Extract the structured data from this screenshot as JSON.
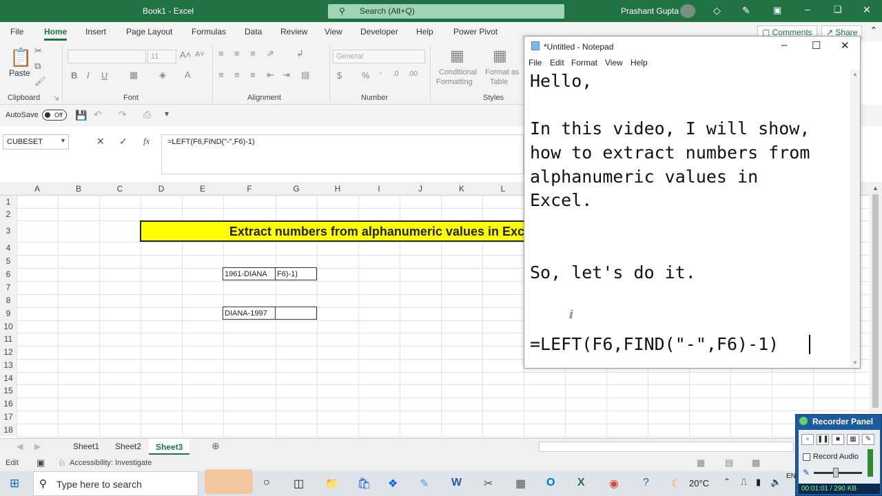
{
  "excel": {
    "window_title": "Book1 - Excel",
    "search_placeholder": "Search (Alt+Q)",
    "user": "Prashant Gupta",
    "tabs": [
      "File",
      "Home",
      "Insert",
      "Page Layout",
      "Formulas",
      "Data",
      "Review",
      "View",
      "Developer",
      "Help",
      "Power Pivot"
    ],
    "active_tab": "Home",
    "comments": "Comments",
    "share": "Share",
    "groups": {
      "clipboard": "Clipboard",
      "font": "Font",
      "alignment": "Alignment",
      "number": "Number",
      "styles": "Styles"
    },
    "paste": "Paste",
    "font_size": "11",
    "number_format": "General",
    "conditional": "Conditional",
    "formatting": "Formatting",
    "format_as": "Format as",
    "table": "Table",
    "autosave": "AutoSave",
    "autosave_state": "Off",
    "namebox": "CUBESET",
    "formula": "=LEFT(F6,FIND(\"-\",F6)-1)",
    "fx": "fx",
    "columns": [
      "A",
      "B",
      "C",
      "D",
      "E",
      "F",
      "G",
      "H",
      "I",
      "J",
      "K",
      "L"
    ],
    "rows": [
      "1",
      "2",
      "3",
      "4",
      "5",
      "6",
      "7",
      "8",
      "9",
      "10",
      "11",
      "12",
      "13",
      "14",
      "15",
      "16",
      "17",
      "18"
    ],
    "banner": "Extract numbers from alphanumeric values in Exc",
    "cells": {
      "F6": "1961-DIANA",
      "G6": "F6)-1)",
      "F9": "DIANA-1997",
      "G9": ""
    },
    "sheets": [
      "Sheet1",
      "Sheet2",
      "Sheet3"
    ],
    "active_sheet": "Sheet3",
    "status_mode": "Edit",
    "accessibility": "Accessibility: Investigate"
  },
  "notepad": {
    "title": "*Untitled - Notepad",
    "menu": [
      "File",
      "Edit",
      "Format",
      "View",
      "Help"
    ],
    "lines": [
      "Hello,",
      "",
      "In this video, I will show,",
      "how to extract numbers from",
      "alphanumeric values in",
      "Excel.",
      "",
      "",
      "So, let's do it.",
      "",
      "",
      "=LEFT(F6,FIND(\"-\",F6)-1)"
    ]
  },
  "recorder": {
    "title": "Recorder Panel",
    "record_audio": "Record Audio",
    "time": "00:01:01 / 290 KB"
  },
  "taskbar": {
    "search_placeholder": "Type here to search",
    "temperature": "20°C",
    "lang": "EN"
  }
}
